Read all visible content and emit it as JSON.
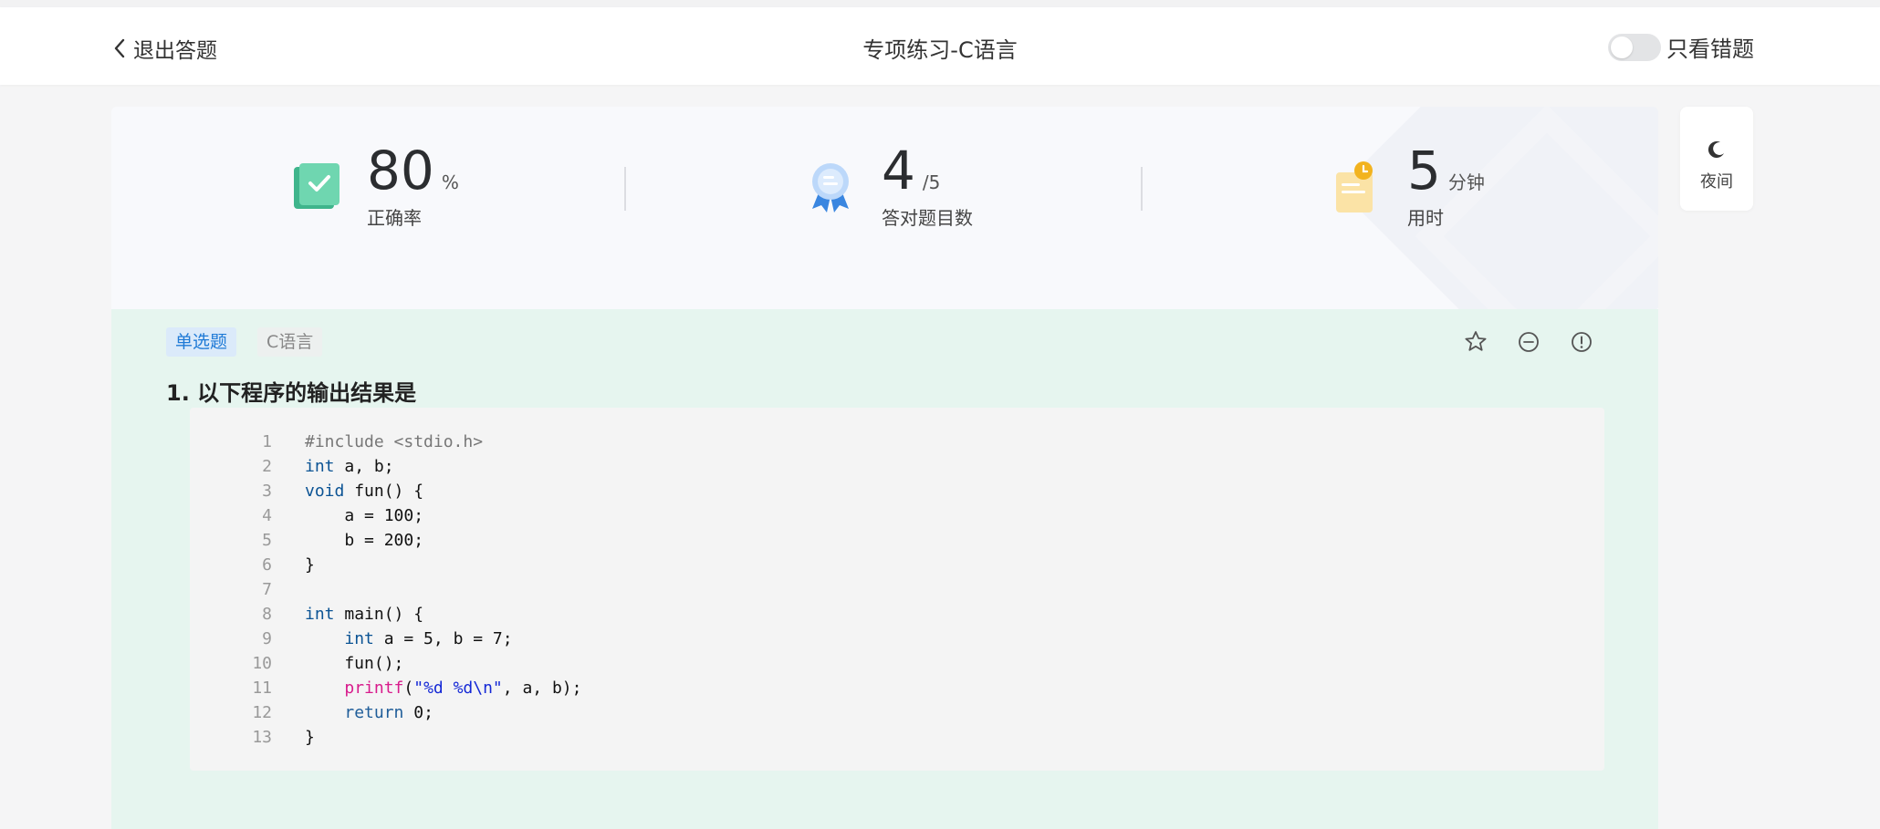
{
  "header": {
    "back_label": "退出答题",
    "title": "专项练习-C语言",
    "toggle_label": "只看错题"
  },
  "stats": [
    {
      "value": "80",
      "unit": "%",
      "label": "正确率",
      "icon": "book-check-icon"
    },
    {
      "value": "4",
      "unit": "/5",
      "label": "答对题目数",
      "icon": "medal-icon"
    },
    {
      "value": "5",
      "unit": "分钟",
      "label": "用时",
      "icon": "clock-note-icon"
    }
  ],
  "night": {
    "label": "夜间",
    "icon": "moon-icon"
  },
  "question": {
    "type_tag": "单选题",
    "lang_tag": "C语言",
    "title": "1. 以下程序的输出结果是",
    "actions": [
      "star-icon",
      "minus-circle-icon",
      "alert-circle-icon"
    ],
    "code_lines": [
      {
        "n": "1",
        "text": "#include <stdio.h>"
      },
      {
        "n": "2",
        "text": "int a, b;"
      },
      {
        "n": "3",
        "text": "void fun() {"
      },
      {
        "n": "4",
        "text": "    a = 100;"
      },
      {
        "n": "5",
        "text": "    b = 200;"
      },
      {
        "n": "6",
        "text": "}"
      },
      {
        "n": "7",
        "text": ""
      },
      {
        "n": "8",
        "text": "int main() {"
      },
      {
        "n": "9",
        "text": "    int a = 5, b = 7;"
      },
      {
        "n": "10",
        "text": "    fun();"
      },
      {
        "n": "11",
        "text": "    printf(\"%d %d\\n\", a, b);"
      },
      {
        "n": "12",
        "text": "    return 0;"
      },
      {
        "n": "13",
        "text": "}"
      }
    ]
  }
}
